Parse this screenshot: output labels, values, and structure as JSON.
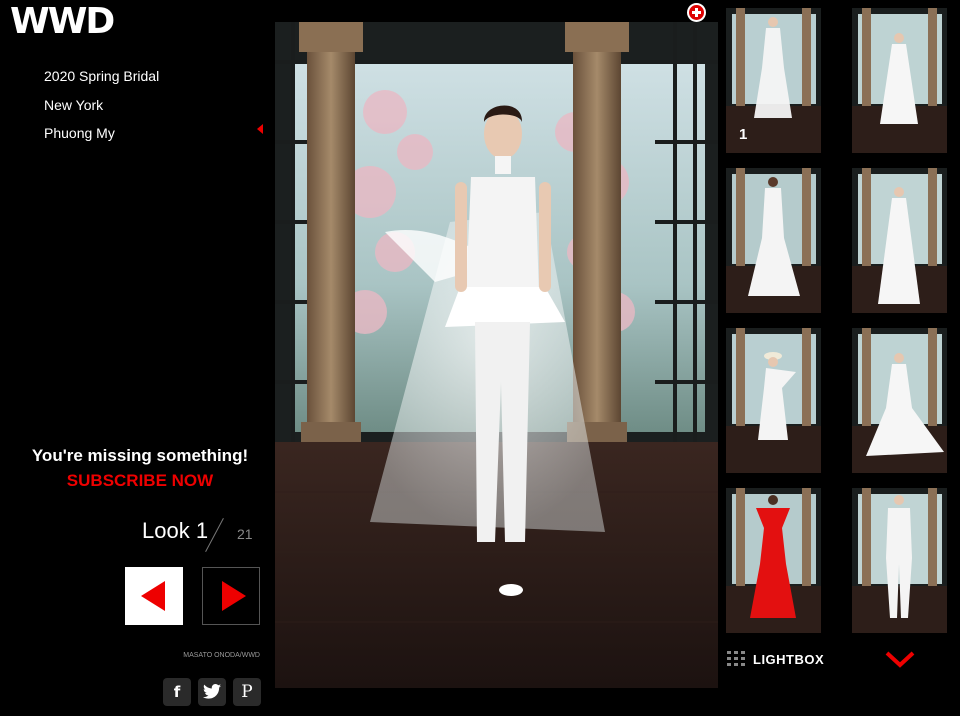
{
  "brand": {
    "logo": "WWD"
  },
  "nav": {
    "items": [
      {
        "label": "2020 Spring Bridal"
      },
      {
        "label": "New York"
      },
      {
        "label": "Phuong My"
      }
    ]
  },
  "promo": {
    "title": "You're missing something!",
    "cta": "SUBSCRIBE NOW"
  },
  "look": {
    "label": "Look 1",
    "total": "21"
  },
  "credit": "MASATO ONODA/WWD",
  "social": {
    "facebook": "f",
    "twitter": "twitter",
    "pinterest": "P"
  },
  "thumbnails": {
    "first_label": "1"
  },
  "lightbox": {
    "label": "LIGHTBOX"
  },
  "colors": {
    "accent": "#e00000",
    "background": "#000000"
  }
}
